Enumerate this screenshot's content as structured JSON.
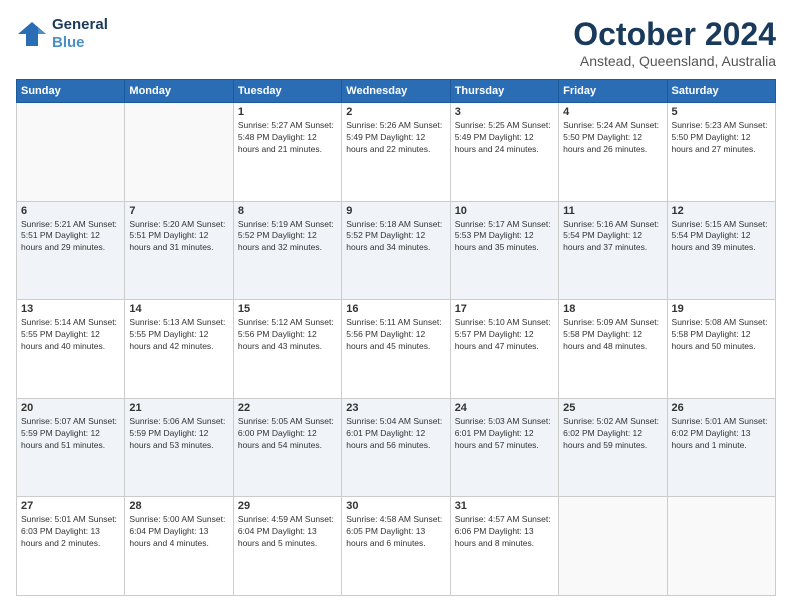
{
  "header": {
    "logo_line1": "General",
    "logo_line2": "Blue",
    "month": "October 2024",
    "location": "Anstead, Queensland, Australia"
  },
  "weekdays": [
    "Sunday",
    "Monday",
    "Tuesday",
    "Wednesday",
    "Thursday",
    "Friday",
    "Saturday"
  ],
  "weeks": [
    [
      {
        "day": "",
        "info": ""
      },
      {
        "day": "",
        "info": ""
      },
      {
        "day": "1",
        "info": "Sunrise: 5:27 AM\nSunset: 5:48 PM\nDaylight: 12 hours and 21 minutes."
      },
      {
        "day": "2",
        "info": "Sunrise: 5:26 AM\nSunset: 5:49 PM\nDaylight: 12 hours and 22 minutes."
      },
      {
        "day": "3",
        "info": "Sunrise: 5:25 AM\nSunset: 5:49 PM\nDaylight: 12 hours and 24 minutes."
      },
      {
        "day": "4",
        "info": "Sunrise: 5:24 AM\nSunset: 5:50 PM\nDaylight: 12 hours and 26 minutes."
      },
      {
        "day": "5",
        "info": "Sunrise: 5:23 AM\nSunset: 5:50 PM\nDaylight: 12 hours and 27 minutes."
      }
    ],
    [
      {
        "day": "6",
        "info": "Sunrise: 5:21 AM\nSunset: 5:51 PM\nDaylight: 12 hours and 29 minutes."
      },
      {
        "day": "7",
        "info": "Sunrise: 5:20 AM\nSunset: 5:51 PM\nDaylight: 12 hours and 31 minutes."
      },
      {
        "day": "8",
        "info": "Sunrise: 5:19 AM\nSunset: 5:52 PM\nDaylight: 12 hours and 32 minutes."
      },
      {
        "day": "9",
        "info": "Sunrise: 5:18 AM\nSunset: 5:52 PM\nDaylight: 12 hours and 34 minutes."
      },
      {
        "day": "10",
        "info": "Sunrise: 5:17 AM\nSunset: 5:53 PM\nDaylight: 12 hours and 35 minutes."
      },
      {
        "day": "11",
        "info": "Sunrise: 5:16 AM\nSunset: 5:54 PM\nDaylight: 12 hours and 37 minutes."
      },
      {
        "day": "12",
        "info": "Sunrise: 5:15 AM\nSunset: 5:54 PM\nDaylight: 12 hours and 39 minutes."
      }
    ],
    [
      {
        "day": "13",
        "info": "Sunrise: 5:14 AM\nSunset: 5:55 PM\nDaylight: 12 hours and 40 minutes."
      },
      {
        "day": "14",
        "info": "Sunrise: 5:13 AM\nSunset: 5:55 PM\nDaylight: 12 hours and 42 minutes."
      },
      {
        "day": "15",
        "info": "Sunrise: 5:12 AM\nSunset: 5:56 PM\nDaylight: 12 hours and 43 minutes."
      },
      {
        "day": "16",
        "info": "Sunrise: 5:11 AM\nSunset: 5:56 PM\nDaylight: 12 hours and 45 minutes."
      },
      {
        "day": "17",
        "info": "Sunrise: 5:10 AM\nSunset: 5:57 PM\nDaylight: 12 hours and 47 minutes."
      },
      {
        "day": "18",
        "info": "Sunrise: 5:09 AM\nSunset: 5:58 PM\nDaylight: 12 hours and 48 minutes."
      },
      {
        "day": "19",
        "info": "Sunrise: 5:08 AM\nSunset: 5:58 PM\nDaylight: 12 hours and 50 minutes."
      }
    ],
    [
      {
        "day": "20",
        "info": "Sunrise: 5:07 AM\nSunset: 5:59 PM\nDaylight: 12 hours and 51 minutes."
      },
      {
        "day": "21",
        "info": "Sunrise: 5:06 AM\nSunset: 5:59 PM\nDaylight: 12 hours and 53 minutes."
      },
      {
        "day": "22",
        "info": "Sunrise: 5:05 AM\nSunset: 6:00 PM\nDaylight: 12 hours and 54 minutes."
      },
      {
        "day": "23",
        "info": "Sunrise: 5:04 AM\nSunset: 6:01 PM\nDaylight: 12 hours and 56 minutes."
      },
      {
        "day": "24",
        "info": "Sunrise: 5:03 AM\nSunset: 6:01 PM\nDaylight: 12 hours and 57 minutes."
      },
      {
        "day": "25",
        "info": "Sunrise: 5:02 AM\nSunset: 6:02 PM\nDaylight: 12 hours and 59 minutes."
      },
      {
        "day": "26",
        "info": "Sunrise: 5:01 AM\nSunset: 6:02 PM\nDaylight: 13 hours and 1 minute."
      }
    ],
    [
      {
        "day": "27",
        "info": "Sunrise: 5:01 AM\nSunset: 6:03 PM\nDaylight: 13 hours and 2 minutes."
      },
      {
        "day": "28",
        "info": "Sunrise: 5:00 AM\nSunset: 6:04 PM\nDaylight: 13 hours and 4 minutes."
      },
      {
        "day": "29",
        "info": "Sunrise: 4:59 AM\nSunset: 6:04 PM\nDaylight: 13 hours and 5 minutes."
      },
      {
        "day": "30",
        "info": "Sunrise: 4:58 AM\nSunset: 6:05 PM\nDaylight: 13 hours and 6 minutes."
      },
      {
        "day": "31",
        "info": "Sunrise: 4:57 AM\nSunset: 6:06 PM\nDaylight: 13 hours and 8 minutes."
      },
      {
        "day": "",
        "info": ""
      },
      {
        "day": "",
        "info": ""
      }
    ]
  ]
}
